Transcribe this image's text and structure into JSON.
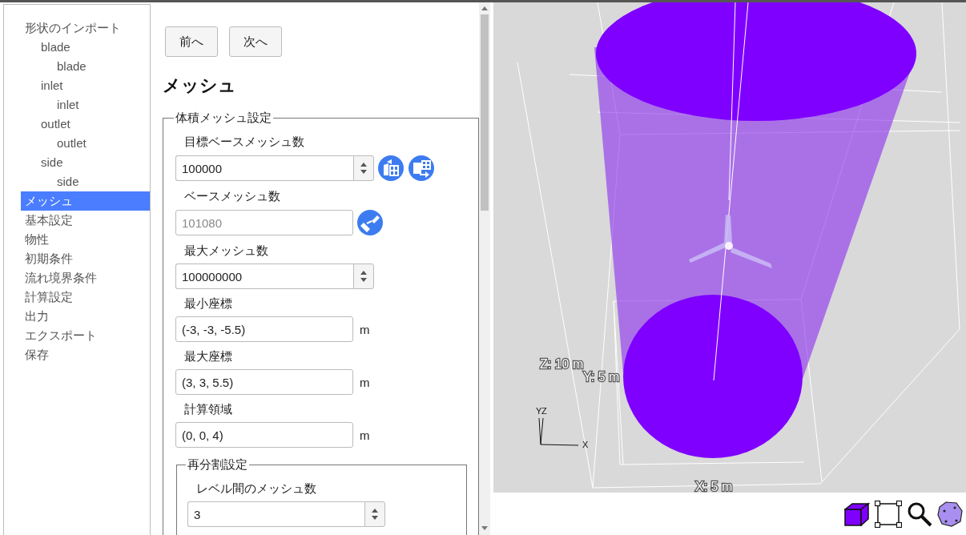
{
  "sidebar": {
    "items": [
      {
        "label": "形状のインポート",
        "selected": false,
        "children": [
          {
            "label": "blade",
            "selected": false,
            "children": [
              {
                "label": "blade",
                "selected": false
              }
            ]
          },
          {
            "label": "inlet",
            "selected": false,
            "children": [
              {
                "label": "inlet",
                "selected": false
              }
            ]
          },
          {
            "label": "outlet",
            "selected": false,
            "children": [
              {
                "label": "outlet",
                "selected": false
              }
            ]
          },
          {
            "label": "side",
            "selected": false,
            "children": [
              {
                "label": "side",
                "selected": false
              }
            ]
          }
        ]
      },
      {
        "label": "メッシュ",
        "selected": true
      },
      {
        "label": "基本設定",
        "selected": false
      },
      {
        "label": "物性",
        "selected": false
      },
      {
        "label": "初期条件",
        "selected": false
      },
      {
        "label": "流れ境界条件",
        "selected": false
      },
      {
        "label": "計算設定",
        "selected": false
      },
      {
        "label": "出力",
        "selected": false
      },
      {
        "label": "エクスポート",
        "selected": false
      },
      {
        "label": "保存",
        "selected": false
      }
    ]
  },
  "nav_buttons": [
    "前へ",
    "次へ"
  ],
  "heading": "メッシュ",
  "fieldset": {
    "legend": "体積メッシュ設定",
    "fields": [
      {
        "label": "目標ベースメッシュ数",
        "value": "100000",
        "kind": "spin-transfer",
        "disabled": false
      },
      {
        "label": "ベースメッシュ数",
        "value": "101080",
        "kind": "text-brush",
        "disabled": true
      },
      {
        "label": "最大メッシュ数",
        "value": "100000000",
        "kind": "spin",
        "disabled": false
      },
      {
        "label": "最小座標",
        "value": "(-3, -3, -5.5)",
        "kind": "text",
        "disabled": false,
        "unit": "m"
      },
      {
        "label": "最大座標",
        "value": "(3, 3, 5.5)",
        "kind": "text",
        "disabled": false,
        "unit": "m"
      },
      {
        "label": "計算領域",
        "value": "(0, 0, 4)",
        "kind": "text",
        "disabled": false,
        "unit": "m"
      }
    ],
    "subgroup": {
      "legend": "再分割設定",
      "fields": [
        {
          "label": "レベル間のメッシュ数",
          "value": "3",
          "kind": "spin",
          "disabled": false
        }
      ]
    }
  },
  "viewport": {
    "dimension_labels": [
      "Z: 10 m",
      "Y: 5 m",
      "X: 5 m"
    ],
    "axis_triad": [
      "Y",
      "Z",
      "X"
    ]
  }
}
